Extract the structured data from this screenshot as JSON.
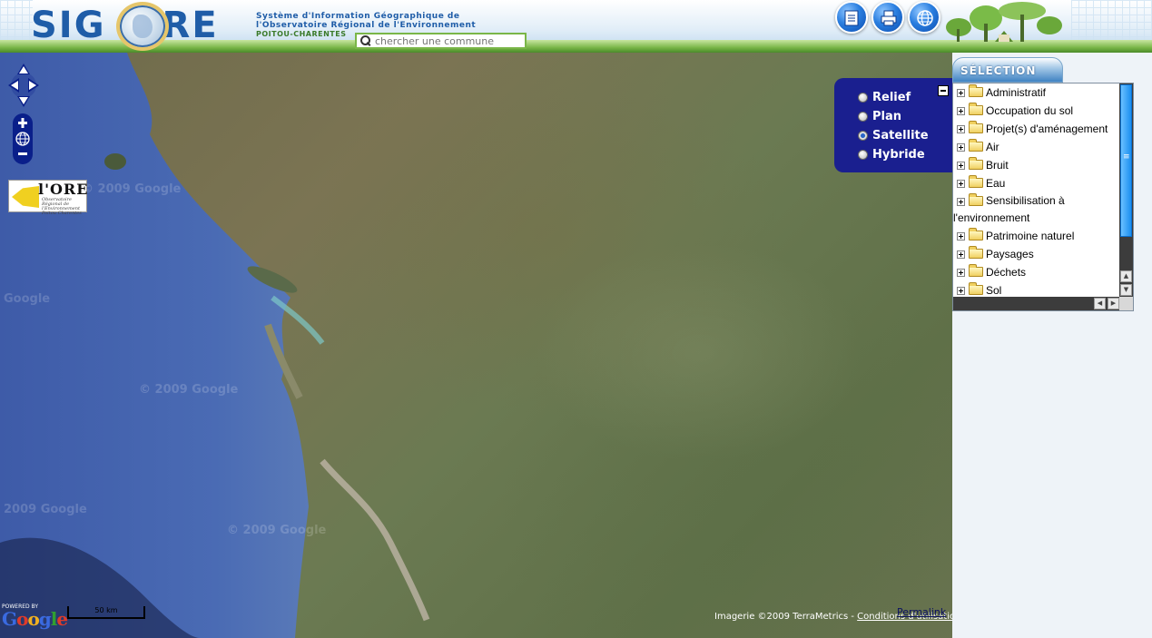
{
  "header": {
    "logo": "SIGORE",
    "tagline_lines": [
      "Système d'Information Géographique de",
      "l'Observatoire Régional de l'Environnement",
      "Poitou-Charentes"
    ],
    "search_placeholder": "chercher une commune",
    "buttons": [
      {
        "name": "document-button",
        "icon": "document-icon"
      },
      {
        "name": "print-button",
        "icon": "printer-icon"
      },
      {
        "name": "globe-button",
        "icon": "globe-icon"
      }
    ]
  },
  "map": {
    "partner_logo": "l'ORE",
    "partner_logo_sub": "Observatoire Régional de l'Environnement Poitou-Charentes",
    "layers": [
      {
        "label": "Relief",
        "checked": false
      },
      {
        "label": "Plan",
        "checked": false
      },
      {
        "label": "Satellite",
        "checked": true
      },
      {
        "label": "Hybride",
        "checked": false
      }
    ],
    "powered_by": "POWERED BY",
    "google_logo": "Google",
    "scale_label": "50 km",
    "copyright_text": "Imagerie ©2009 TerraMetrics - ",
    "terms_link": "Conditions d'utilisation",
    "permalink": "Permalink",
    "watermarks": [
      "© 2009 Google",
      "Google",
      "© 2009 Google",
      "2009 Google",
      "© 2009 Google"
    ]
  },
  "sidebar": {
    "tab_label": "SÉLECTION",
    "tree_items": [
      {
        "label": "Administratif"
      },
      {
        "label": "Occupation du sol"
      },
      {
        "label": "Projet(s) d'aménagement"
      },
      {
        "label": "Air"
      },
      {
        "label": "Bruit"
      },
      {
        "label": "Eau"
      },
      {
        "label": "Sensibilisation à",
        "label2": "l'environnement"
      },
      {
        "label": "Patrimoine naturel"
      },
      {
        "label": "Paysages"
      },
      {
        "label": "Déchets"
      },
      {
        "label": "Sol"
      }
    ]
  },
  "colors": {
    "brand_blue": "#1f5da8",
    "layer_panel": "#1a1f8f",
    "accent_green": "#7ab648"
  }
}
